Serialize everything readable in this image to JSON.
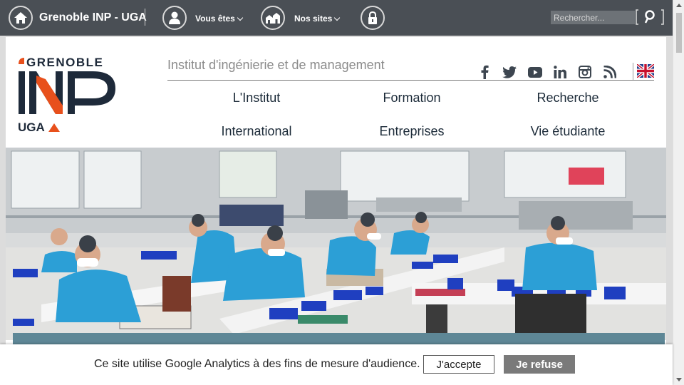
{
  "topbar": {
    "site_name": "Grenoble INP - UGA",
    "vous_etes_label": "Vous êtes",
    "nos_sites_label": "Nos sites",
    "search_placeholder": "Rechercher..."
  },
  "header": {
    "logo_text_top": "GRENOBLE",
    "logo_text_main": "INP",
    "logo_text_bottom": "UGA",
    "tagline": "Institut d'ingénierie et de management",
    "social_icons": [
      "facebook-icon",
      "twitter-icon",
      "youtube-icon",
      "linkedin-icon",
      "instagram-icon",
      "rss-icon"
    ],
    "language_flag": "uk-flag-icon"
  },
  "nav": {
    "items": [
      "L'Institut",
      "Formation",
      "Recherche",
      "International",
      "Entreprises",
      "Vie étudiante"
    ]
  },
  "hero": {
    "image": "workshop-photo"
  },
  "cookie_banner": {
    "text": "Ce site utilise Google Analytics à des fins de mesure d'audience.",
    "accept_label": "J'accepte",
    "refuse_label": "Je refuse"
  },
  "colors": {
    "topbar": "#4a4f55",
    "logo_navy": "#1e2a3a",
    "logo_orange": "#e8501c",
    "hero_band": "#5e8796",
    "refuse_button": "#7a7a7a"
  }
}
